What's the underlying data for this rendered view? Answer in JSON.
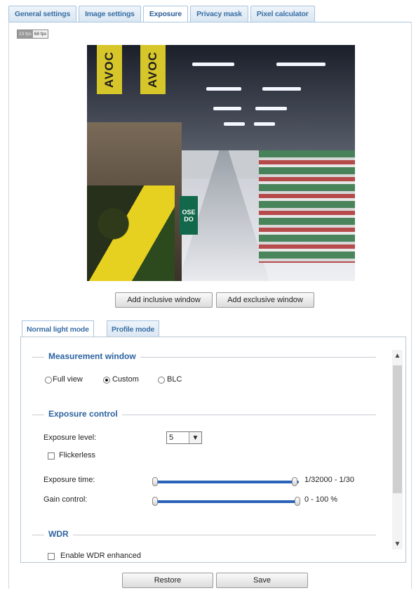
{
  "top_tabs": [
    "General settings",
    "Image settings",
    "Exposure",
    "Privacy mask",
    "Pixel calculator"
  ],
  "fps": {
    "a": "13 fps",
    "b": "68 fps"
  },
  "video": {
    "banner1": "AVOC",
    "banner2": "AVOC",
    "sign": "OSE DO"
  },
  "buttons": {
    "add_inclusive": "Add inclusive window",
    "add_exclusive": "Add exclusive window",
    "restore": "Restore",
    "save": "Save"
  },
  "inner_tabs": [
    "Normal light mode",
    "Profile mode"
  ],
  "measurement": {
    "title": "Measurement window",
    "options": [
      "Full view",
      "Custom",
      "BLC"
    ],
    "selected": "Custom"
  },
  "exposure": {
    "title": "Exposure control",
    "level_label": "Exposure level:",
    "level_value": "5",
    "flickerless_label": "Flickerless",
    "time_label": "Exposure time:",
    "time_range": "1/32000 - 1/30",
    "gain_label": "Gain control:",
    "gain_range": "0 - 100 %"
  },
  "wdr": {
    "title": "WDR",
    "enable_label": "Enable WDR enhanced"
  }
}
